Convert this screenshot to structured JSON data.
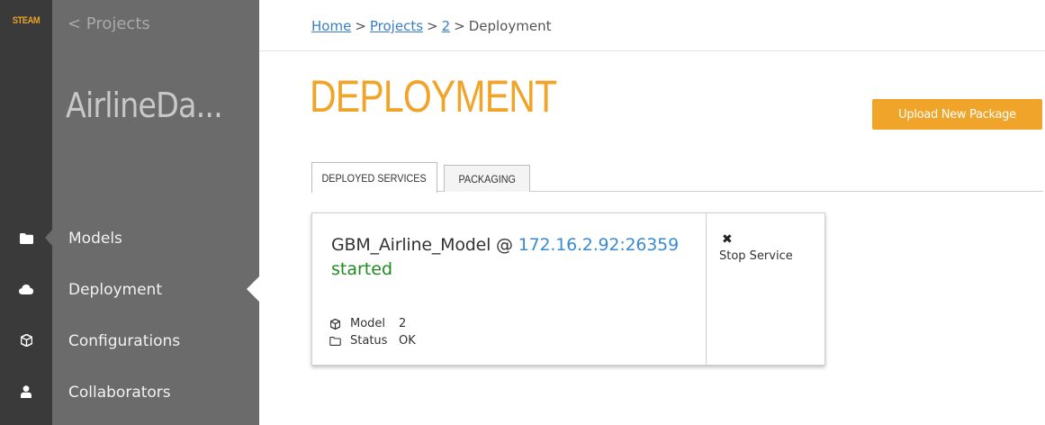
{
  "rail": {
    "logo": "STEAM",
    "icons": [
      "folder-icon",
      "cloud-icon",
      "cube-icon",
      "user-icon"
    ]
  },
  "panel": {
    "back_label": "< Projects",
    "project_name": "AirlineDa...",
    "nav": [
      {
        "label": "Models",
        "icon": "folder-icon"
      },
      {
        "label": "Deployment",
        "icon": "cloud-icon",
        "active": true
      },
      {
        "label": "Configurations",
        "icon": "cube-icon"
      },
      {
        "label": "Collaborators",
        "icon": "user-icon"
      }
    ]
  },
  "breadcrumb": {
    "home": "Home",
    "projects": "Projects",
    "id": "2",
    "current": "Deployment",
    "sep": ">"
  },
  "page": {
    "title": "DEPLOYMENT",
    "upload_label": "Upload New Package"
  },
  "tabs": [
    {
      "label": "DEPLOYED SERVICES",
      "active": true
    },
    {
      "label": "PACKAGING",
      "active": false
    }
  ],
  "service": {
    "name": "GBM_Airline_Model",
    "at": "@",
    "address": "172.16.2.92:26359",
    "state": "started",
    "meta": [
      {
        "icon": "cube-icon",
        "label": "Model",
        "value": "2"
      },
      {
        "icon": "folder-icon",
        "label": "Status",
        "value": "OK"
      }
    ],
    "stop_icon": "✖",
    "stop_label": "Stop Service"
  },
  "colors": {
    "accent": "#f0a52a",
    "rail": "#3a3a3a",
    "panel": "#6b6b6b",
    "link": "#3b7dc4",
    "started": "#1f8a1f"
  }
}
